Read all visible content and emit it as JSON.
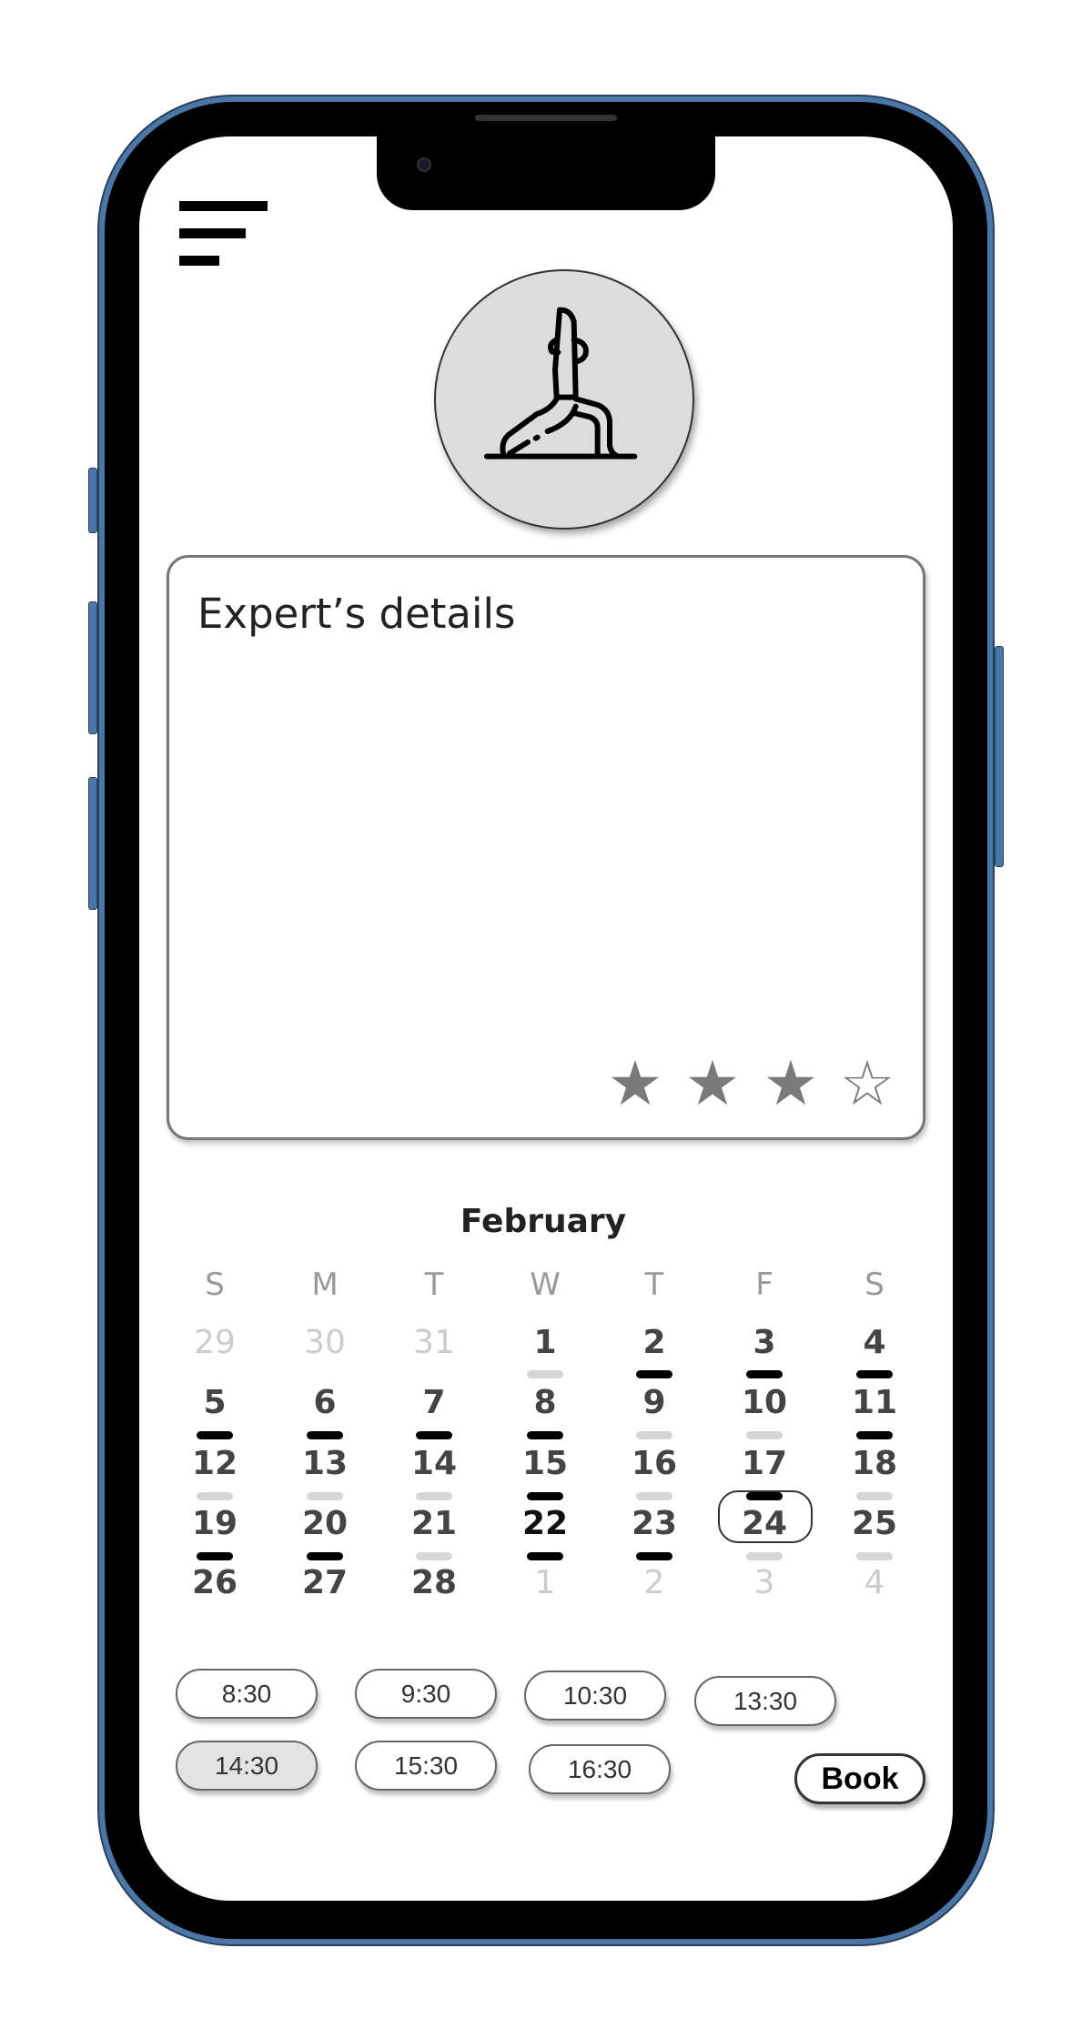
{
  "card": {
    "title": "Expert’s details",
    "rating": 3,
    "rating_max": 5
  },
  "calendar": {
    "month": "February",
    "weekdays": [
      "S",
      "M",
      "T",
      "W",
      "T",
      "F",
      "S"
    ],
    "weeks": [
      [
        {
          "d": "29",
          "m": 1
        },
        {
          "d": "30",
          "m": 1
        },
        {
          "d": "31",
          "m": 1
        },
        {
          "d": "1",
          "b": "light"
        },
        {
          "d": "2",
          "b": "dark"
        },
        {
          "d": "3",
          "b": "dark"
        },
        {
          "d": "4",
          "b": "dark"
        }
      ],
      [
        {
          "d": "5",
          "b": "dark"
        },
        {
          "d": "6",
          "b": "dark"
        },
        {
          "d": "7",
          "b": "dark"
        },
        {
          "d": "8",
          "b": "dark"
        },
        {
          "d": "9",
          "b": "light"
        },
        {
          "d": "10",
          "b": "light"
        },
        {
          "d": "11",
          "b": "dark"
        }
      ],
      [
        {
          "d": "12",
          "b": "light"
        },
        {
          "d": "13",
          "b": "light"
        },
        {
          "d": "14",
          "b": "light"
        },
        {
          "d": "15",
          "b": "dark"
        },
        {
          "d": "16",
          "b": "light"
        },
        {
          "d": "17",
          "b": "dark"
        },
        {
          "d": "18",
          "b": "light"
        }
      ],
      [
        {
          "d": "19",
          "b": "dark"
        },
        {
          "d": "20",
          "b": "dark"
        },
        {
          "d": "21",
          "b": "light"
        },
        {
          "d": "22",
          "b": "dark",
          "s": 1
        },
        {
          "d": "23",
          "b": "dark"
        },
        {
          "d": "24",
          "b": "light"
        },
        {
          "d": "25",
          "b": "light"
        }
      ],
      [
        {
          "d": "26"
        },
        {
          "d": "27"
        },
        {
          "d": "28"
        },
        {
          "d": "1",
          "m": 1
        },
        {
          "d": "2",
          "m": 1
        },
        {
          "d": "3",
          "m": 1
        },
        {
          "d": "4",
          "m": 1
        }
      ]
    ],
    "selected_day": "24"
  },
  "time_slots": [
    "8:30",
    "9:30",
    "10:30",
    "13:30",
    "14:30",
    "15:30",
    "16:30"
  ],
  "selected_slot": "14:30",
  "book_label": "Book",
  "icons": {
    "menu": "menu-icon",
    "avatar": "yoga-pose-icon",
    "star_filled": "star-filled-icon",
    "star_empty": "star-outline-icon"
  }
}
